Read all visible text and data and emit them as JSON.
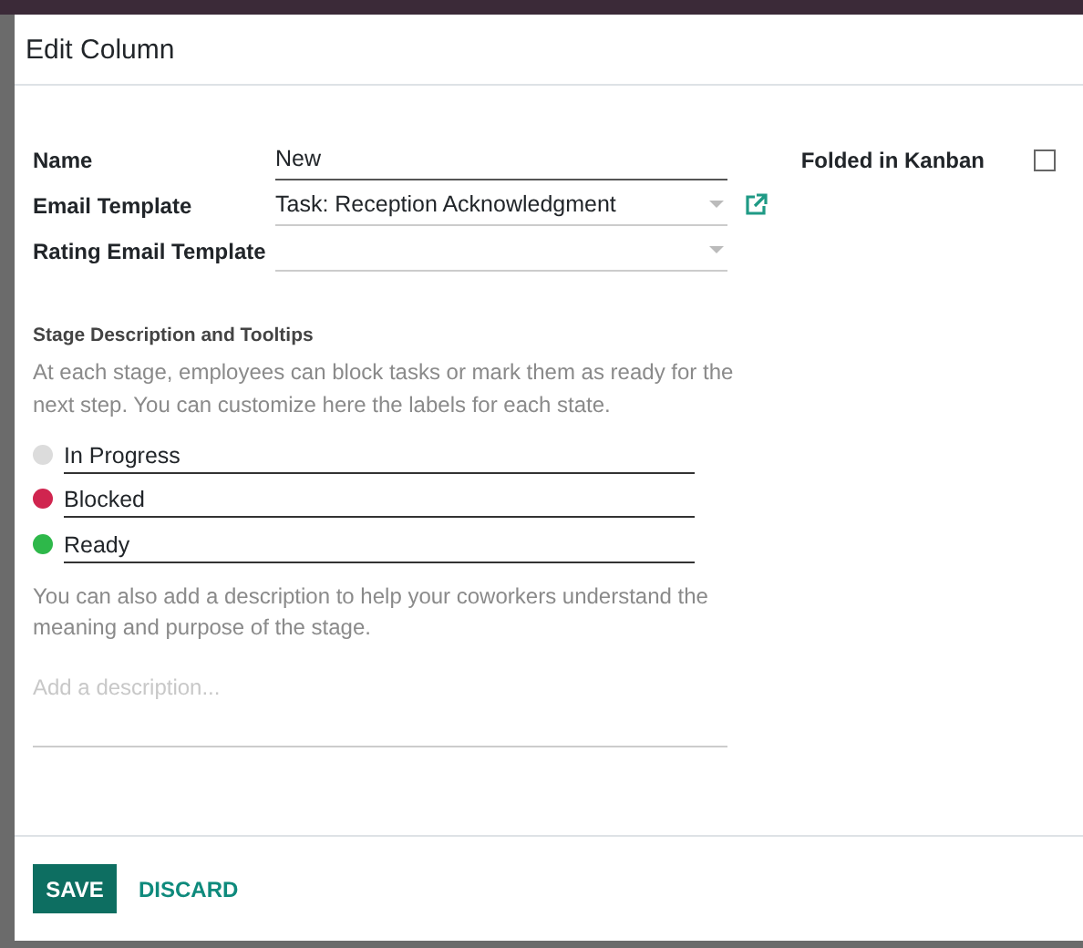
{
  "dialog": {
    "title": "Edit Column"
  },
  "fields": [
    {
      "kind": "text",
      "label": "Name",
      "value": "New"
    },
    {
      "kind": "select",
      "label": "Email Template",
      "value": "Task: Reception Acknowledgment",
      "external_link": true
    },
    {
      "kind": "select",
      "label": "Rating Email Template",
      "external_link": false
    }
  ],
  "folded": {
    "label": "Folded in Kanban",
    "checked": false
  },
  "section": {
    "title": "Stage Description and Tooltips",
    "intro": "At each stage, employees can block tasks or mark them as ready for the next step. You can customize here the labels for each state."
  },
  "states": [
    {
      "label": "In Progress",
      "color": "#dcdcdc"
    },
    {
      "label": "Blocked",
      "color": "#d0254f"
    },
    {
      "label": "Ready",
      "color": "#2eb84a"
    }
  ],
  "description": {
    "help": "You can also add a description to help your coworkers understand the meaning and purpose of the stage.",
    "placeholder": "Add a description..."
  },
  "buttons": [
    {
      "kind": "primary",
      "label": "SAVE"
    },
    {
      "kind": "link",
      "label": "DISCARD"
    }
  ]
}
